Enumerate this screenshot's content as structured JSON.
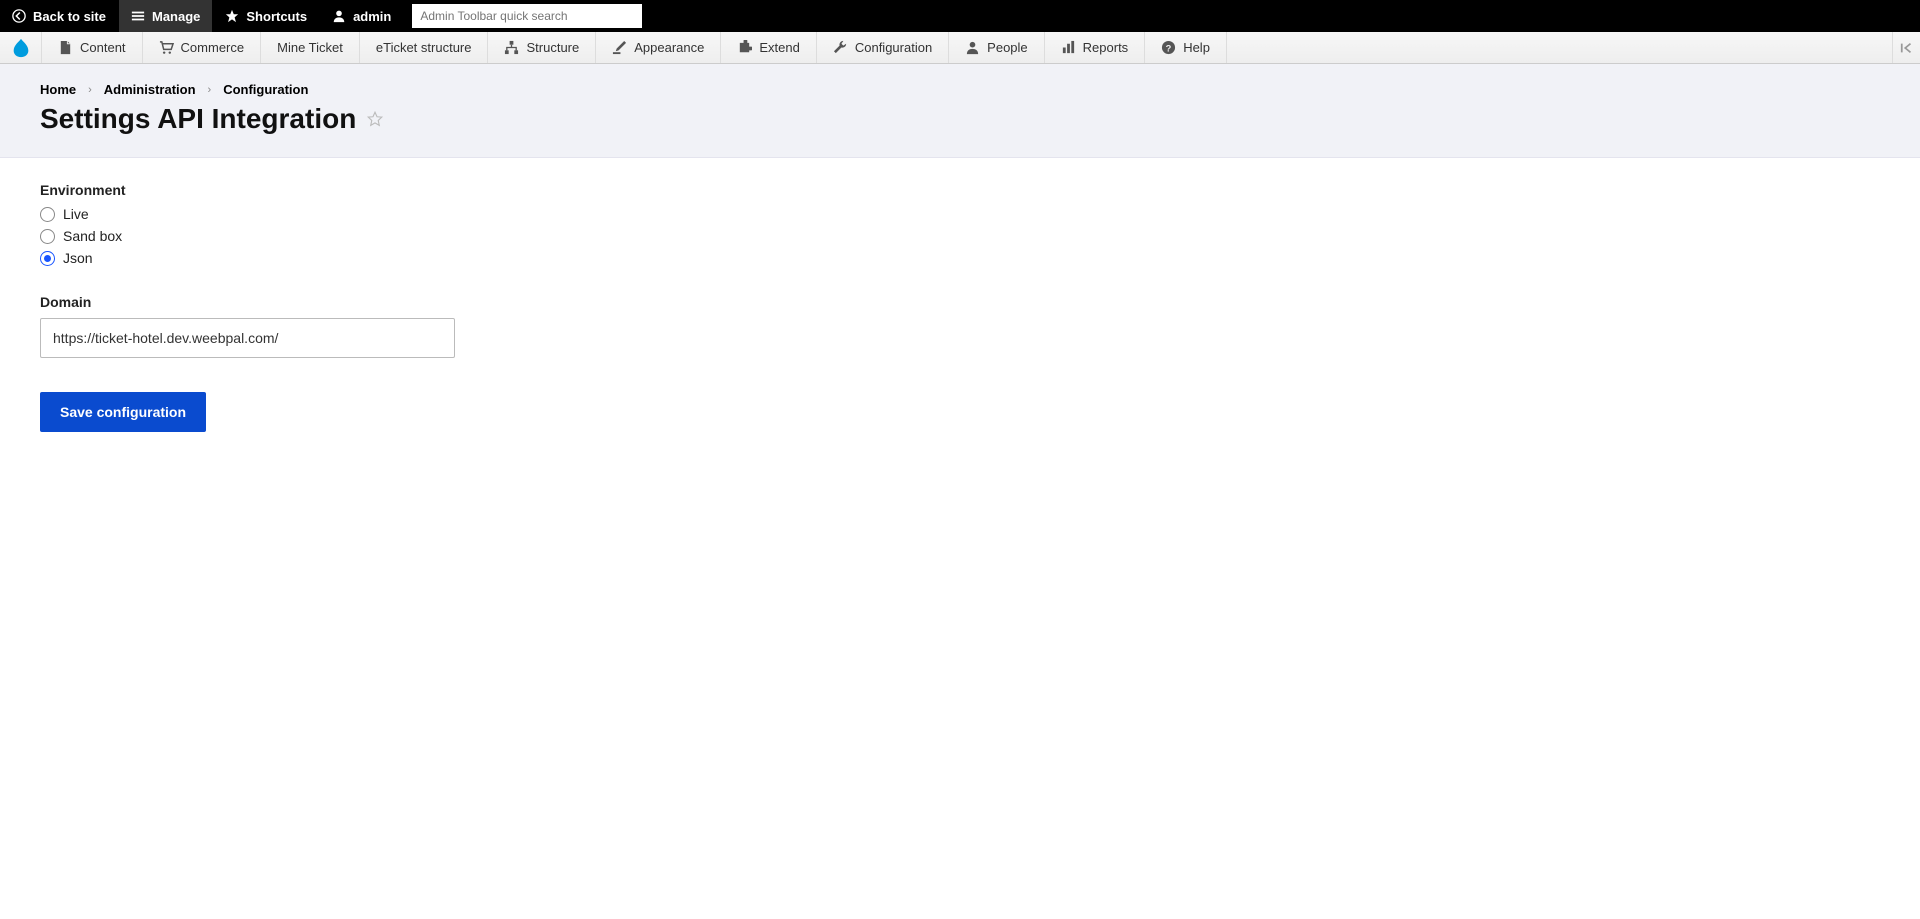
{
  "toolbar": {
    "back_to_site": "Back to site",
    "manage": "Manage",
    "shortcuts": "Shortcuts",
    "admin": "admin",
    "search_placeholder": "Admin Toolbar quick search"
  },
  "admin_menu": {
    "items": [
      {
        "label": "Content",
        "icon": "file"
      },
      {
        "label": "Commerce",
        "icon": "cart"
      },
      {
        "label": "Mine Ticket",
        "icon": ""
      },
      {
        "label": "eTicket structure",
        "icon": ""
      },
      {
        "label": "Structure",
        "icon": "hierarchy"
      },
      {
        "label": "Appearance",
        "icon": "brush"
      },
      {
        "label": "Extend",
        "icon": "puzzle"
      },
      {
        "label": "Configuration",
        "icon": "wrench"
      },
      {
        "label": "People",
        "icon": "person"
      },
      {
        "label": "Reports",
        "icon": "bars"
      },
      {
        "label": "Help",
        "icon": "help"
      }
    ]
  },
  "breadcrumb": {
    "items": [
      "Home",
      "Administration",
      "Configuration"
    ]
  },
  "page": {
    "title": "Settings API Integration"
  },
  "form": {
    "environment_label": "Environment",
    "environment_options": [
      {
        "label": "Live",
        "checked": false
      },
      {
        "label": "Sand box",
        "checked": false
      },
      {
        "label": "Json",
        "checked": true
      }
    ],
    "domain_label": "Domain",
    "domain_value": "https://ticket-hotel.dev.weebpal.com/",
    "submit_label": "Save configuration"
  }
}
